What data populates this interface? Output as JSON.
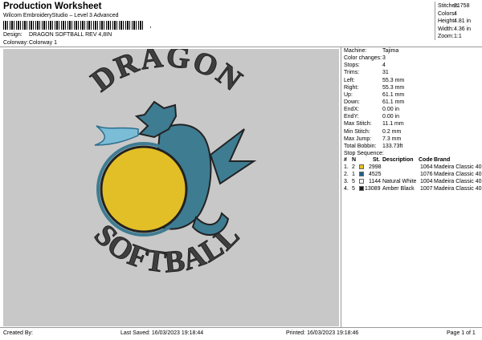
{
  "header": {
    "title": "Production Worksheet",
    "subtitle": "Wilcom EmbroideryStudio – Level 3 Advanced",
    "barcode_suffix": ","
  },
  "meta": {
    "design_label": "Design:",
    "design_value": "DRAGON SOFTBALL REV 4,8IN",
    "colorway_label": "Colorway:",
    "colorway_value": "Colorway 1"
  },
  "stats": [
    {
      "label": "Stitches:",
      "value": "21758"
    },
    {
      "label": "Colors:",
      "value": "4"
    },
    {
      "label": "Height:",
      "value": "4.81 in"
    },
    {
      "label": "Width:",
      "value": "4.36 in"
    },
    {
      "label": "Zoom:",
      "value": "1:1"
    }
  ],
  "artwork": {
    "top_text": "DRAGON",
    "bottom_text": "SOFTBALL",
    "colors": {
      "bg": "#c8c8c8",
      "text": "#3f3f3f",
      "ball": "#e3bf27",
      "dragon": "#3e7c92",
      "fire": "#7bbcd6"
    }
  },
  "machine_info": [
    {
      "label": "Machine:",
      "value": "Tajima"
    },
    {
      "label": "Color changes:",
      "value": "3"
    },
    {
      "label": "Stops:",
      "value": "4"
    },
    {
      "label": "Trims:",
      "value": "31"
    },
    {
      "label": "Left:",
      "value": "55.3 mm"
    },
    {
      "label": "Right:",
      "value": "55.3 mm"
    },
    {
      "label": "Up:",
      "value": "61.1 mm"
    },
    {
      "label": "Down:",
      "value": "61.1 mm"
    },
    {
      "label": "EndX:",
      "value": "0.00 in"
    },
    {
      "label": "EndY:",
      "value": "0.00 in"
    },
    {
      "label": "Max Stitch:",
      "value": "11.1 mm"
    },
    {
      "label": "Min Stitch:",
      "value": "0.2 mm"
    },
    {
      "label": "Max Jump:",
      "value": "7.3 mm"
    },
    {
      "label": "Total Bobbin:",
      "value": "133.73ft"
    }
  ],
  "stop_sequence": {
    "title": "Stop Sequence:",
    "headers": {
      "num": "#",
      "n": "N",
      "st": "St.",
      "description": "Description",
      "code": "Code",
      "brand": "Brand"
    },
    "rows": [
      {
        "num": "1.",
        "n": "2",
        "color": "#e3bf27",
        "st": "2998",
        "description": "",
        "code": "1064",
        "brand": "Madeira Classic 40"
      },
      {
        "num": "2.",
        "n": "1",
        "color": "#1f5f8a",
        "st": "4525",
        "description": "",
        "code": "1076",
        "brand": "Madeira Classic 40"
      },
      {
        "num": "3.",
        "n": "5",
        "color": "#f4f4f4",
        "st": "1144",
        "description": "Natural White",
        "code": "1004",
        "brand": "Madeira Classic 40"
      },
      {
        "num": "4.",
        "n": "5",
        "color": "#1b1b1b",
        "st": "13089",
        "description": "Amber Black",
        "code": "1007",
        "brand": "Madeira Classic 40"
      }
    ]
  },
  "footer": {
    "created": "Created By:",
    "saved": "Last Saved: 16/03/2023 19:18:44",
    "printed": "Printed: 16/03/2023 19:18:46",
    "page": "Page 1 of 1"
  }
}
